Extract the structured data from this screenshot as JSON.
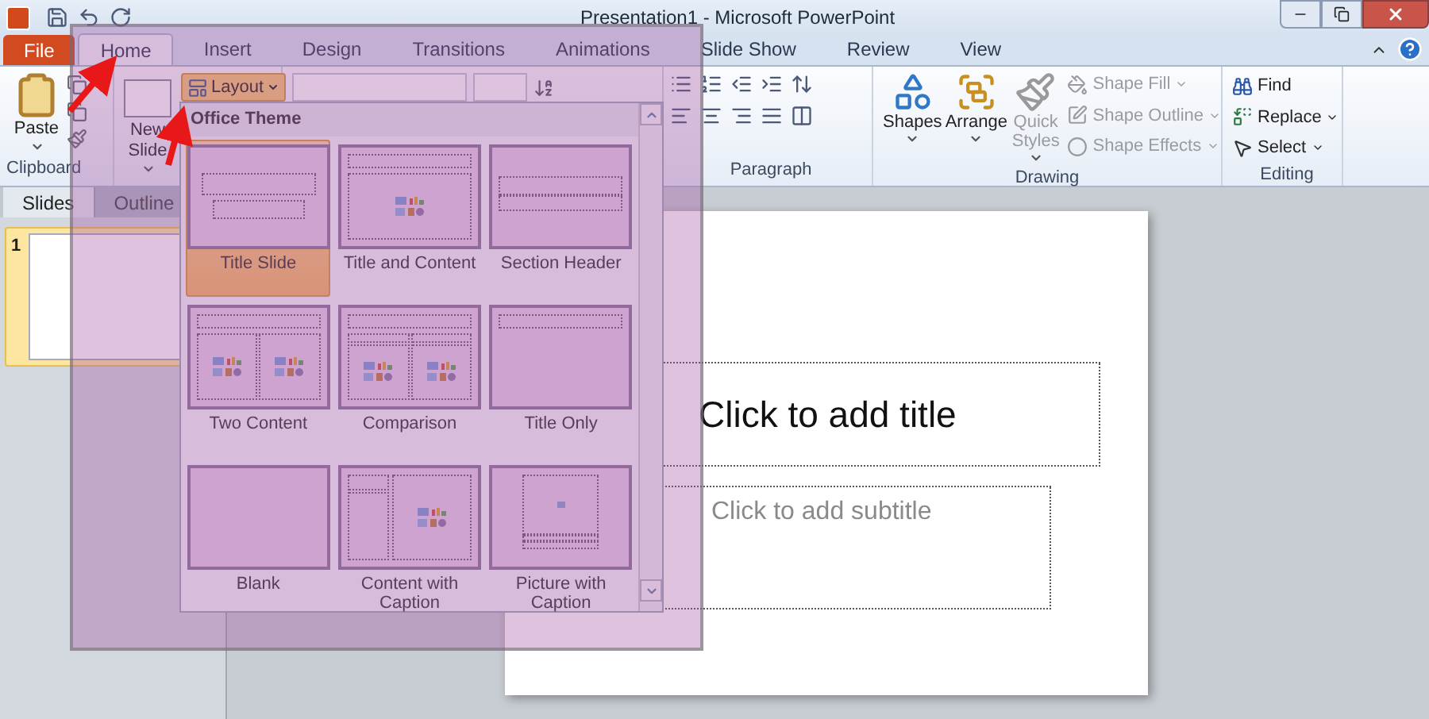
{
  "window": {
    "title": "Presentation1 - Microsoft PowerPoint"
  },
  "tabs": [
    {
      "label": "File",
      "kind": "file",
      "selected": false
    },
    {
      "label": "Home",
      "kind": "tab",
      "selected": true
    },
    {
      "label": "Insert",
      "kind": "tab",
      "selected": false
    },
    {
      "label": "Design",
      "kind": "tab",
      "selected": false
    },
    {
      "label": "Transitions",
      "kind": "tab",
      "selected": false
    },
    {
      "label": "Animations",
      "kind": "tab",
      "selected": false
    },
    {
      "label": "Slide Show",
      "kind": "tab",
      "selected": false
    },
    {
      "label": "Review",
      "kind": "tab",
      "selected": false
    },
    {
      "label": "View",
      "kind": "tab",
      "selected": false
    }
  ],
  "ribbon": {
    "clipboard": {
      "label": "Clipboard",
      "paste": "Paste"
    },
    "slides": {
      "new_slide": "New Slide",
      "layout": "Layout"
    },
    "paragraph": {
      "label": "Paragraph"
    },
    "drawing": {
      "label": "Drawing",
      "large": [
        {
          "label": "Shapes",
          "kind": "shapes",
          "disabled": false
        },
        {
          "label": "Arrange",
          "kind": "arrange",
          "disabled": false
        },
        {
          "label": "Quick Styles",
          "kind": "styles",
          "disabled": true
        }
      ],
      "small": [
        {
          "label": "Shape Fill",
          "kind": "fill",
          "disabled": true
        },
        {
          "label": "Shape Outline",
          "kind": "outline",
          "disabled": true
        },
        {
          "label": "Shape Effects",
          "kind": "effects",
          "disabled": true
        }
      ]
    },
    "editing": {
      "label": "Editing",
      "items": [
        {
          "label": "Find",
          "kind": "find"
        },
        {
          "label": "Replace",
          "kind": "replace"
        },
        {
          "label": "Select",
          "kind": "select"
        }
      ]
    }
  },
  "side_panel": {
    "tabs": [
      {
        "label": "Slides",
        "selected": true
      },
      {
        "label": "Outline",
        "selected": false
      }
    ],
    "slides": [
      {
        "number": "1",
        "selected": true
      }
    ]
  },
  "slide": {
    "title_placeholder": "Click to add title",
    "subtitle_placeholder": "Click to add subtitle"
  },
  "layout_gallery": {
    "header": "Office Theme",
    "layouts": [
      {
        "label": "Title Slide",
        "kind": "title",
        "selected": true
      },
      {
        "label": "Title and Content",
        "kind": "title_content",
        "selected": false
      },
      {
        "label": "Section Header",
        "kind": "section",
        "selected": false
      },
      {
        "label": "Two Content",
        "kind": "two",
        "selected": false
      },
      {
        "label": "Comparison",
        "kind": "comparison",
        "selected": false
      },
      {
        "label": "Title Only",
        "kind": "title_only",
        "selected": false
      },
      {
        "label": "Blank",
        "kind": "blank",
        "selected": false
      },
      {
        "label": "Content with Caption",
        "kind": "content_caption",
        "selected": false
      },
      {
        "label": "Picture with Caption",
        "kind": "picture_caption",
        "selected": false
      }
    ]
  }
}
